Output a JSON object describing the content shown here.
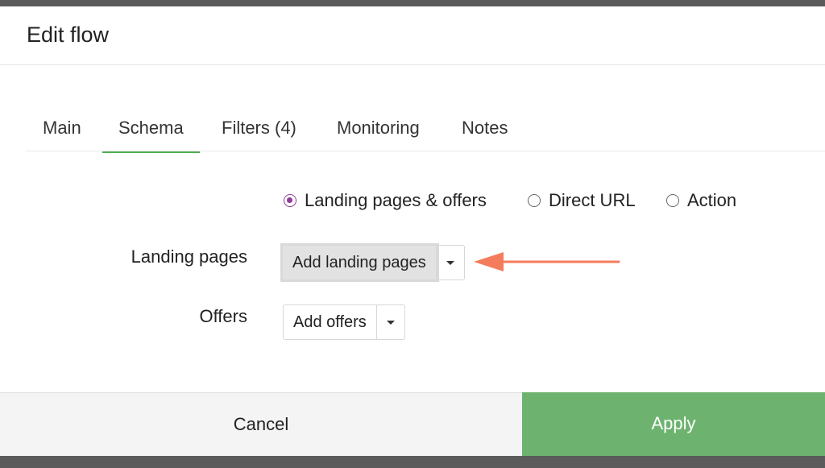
{
  "modal": {
    "title": "Edit flow"
  },
  "tabs": [
    {
      "label": "Main"
    },
    {
      "label": "Schema"
    },
    {
      "label": "Filters (4)"
    },
    {
      "label": "Monitoring"
    },
    {
      "label": "Notes"
    }
  ],
  "active_tab": "Schema",
  "schema": {
    "radio_options": [
      {
        "label": "Landing pages & offers",
        "checked": true
      },
      {
        "label": "Direct URL",
        "checked": false
      },
      {
        "label": "Action",
        "checked": false
      }
    ],
    "landing_pages_label": "Landing pages",
    "add_landing_pages": "Add landing pages",
    "offers_label": "Offers",
    "add_offers": "Add offers"
  },
  "footer": {
    "cancel": "Cancel",
    "apply": "Apply"
  },
  "colors": {
    "accent_green": "#6db36f",
    "tab_underline": "#4caf50",
    "radio_checked": "#8e3a98",
    "annotation_arrow": "#f47c5c"
  },
  "icons": {
    "dropdown": "caret-down-icon",
    "annotation": "arrow-left-icon"
  }
}
